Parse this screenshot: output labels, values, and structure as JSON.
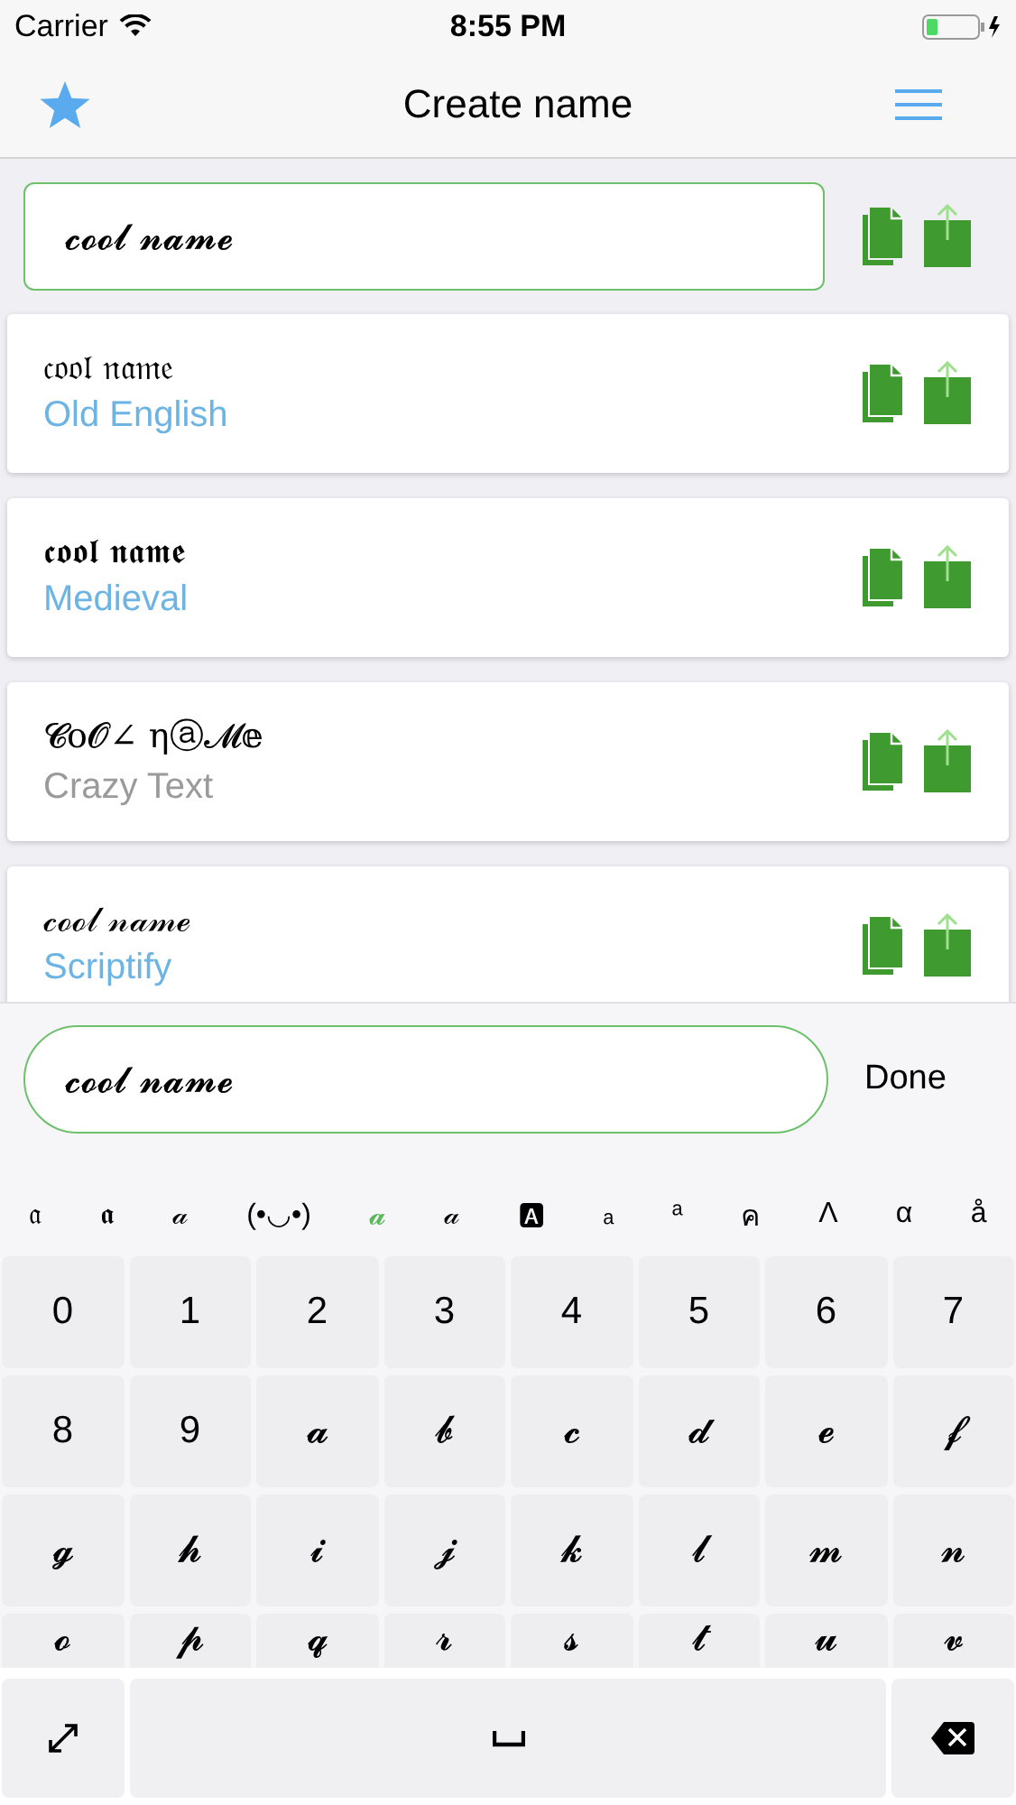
{
  "status_bar": {
    "carrier": "Carrier",
    "time": "8:55 PM"
  },
  "nav": {
    "title": "Create name"
  },
  "input": {
    "value": "𝓬𝓸𝓸𝓵 𝓷𝓪𝓶𝓮"
  },
  "styles": [
    {
      "text": "𝔠𝔬𝔬𝔩 𝔫𝔞𝔪𝔢",
      "name": "Old English",
      "color": "#6cb4e4"
    },
    {
      "text": "𝖈𝖔𝖔𝖑 𝖓𝖆𝖒𝖊",
      "name": "Medieval",
      "color": "#6cb4e4"
    },
    {
      "text": "𝓒o𝓞∠ ηⓐ𝓜𝕖",
      "name": "Crazy Text",
      "color": "#9a9a9a"
    },
    {
      "text": "𝒸ℴℴ𝓁 𝓃𝒶𝓂ℯ",
      "name": "Scriptify",
      "color": "#6cb4e4"
    }
  ],
  "accessory": {
    "value": "𝓬𝓸𝓸𝓵 𝓷𝓪𝓶𝓮",
    "done": "Done"
  },
  "suggestions": [
    {
      "label": "𝔞",
      "selected": false
    },
    {
      "label": "𝖆",
      "selected": false
    },
    {
      "label": "𝒶",
      "selected": false
    },
    {
      "label": "(•◡•)",
      "selected": false
    },
    {
      "label": "𝓪",
      "selected": true
    },
    {
      "label": "𝒶",
      "selected": false
    },
    {
      "label": "🅰",
      "selected": false
    },
    {
      "label": "ₐ",
      "selected": false
    },
    {
      "label": "ᵃ",
      "selected": false
    },
    {
      "label": "ค",
      "selected": false
    },
    {
      "label": "Λ",
      "selected": false
    },
    {
      "label": "α",
      "selected": false
    },
    {
      "label": "å",
      "selected": false
    }
  ],
  "keys": [
    "0",
    "1",
    "2",
    "3",
    "4",
    "5",
    "6",
    "7",
    "8",
    "9",
    "𝓪",
    "𝓫",
    "𝓬",
    "𝓭",
    "𝓮",
    "𝓯",
    "𝓰",
    "𝓱",
    "𝓲",
    "𝓳",
    "𝓴",
    "𝓵",
    "𝓶",
    "𝓷",
    "𝓸",
    "𝓹",
    "𝓺",
    "𝓻",
    "𝓼",
    "𝓽",
    "𝓾",
    "𝓿"
  ]
}
